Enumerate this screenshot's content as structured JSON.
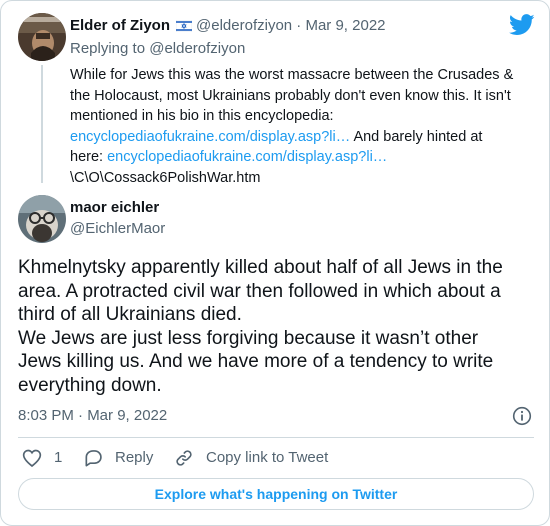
{
  "parent_tweet": {
    "display_name": "Elder of Ziyon",
    "handle": "@elderofziyon",
    "separator": "·",
    "date": "Mar 9, 2022",
    "replying_label": "Replying to @elderofziyon",
    "text_lines": [
      "While for Jews this was the worst massacre between the Crusades &",
      "the Holocaust, most Ukrainians probably don't even know this. It isn't",
      "mentioned in his bio in this encyclopedia:"
    ],
    "link_1": "encyclopediaofukraine.com/display.asp?li…",
    "link_1_after": " And barely hinted at",
    "link_2_before": "here: ",
    "link_2": "encyclopediaofukraine.com/display.asp?li…",
    "last_line": "\\C\\O\\Cossack6PolishWar.htm"
  },
  "main_tweet": {
    "display_name": "maor eichler",
    "handle": "@EichlerMaor",
    "text_lines": [
      "Khmelnytsky apparently killed about half of all Jews in the",
      "area. A protracted civil war then followed in which about a",
      "third of all Ukrainians died.",
      "We Jews are just less forgiving because it wasn’t other",
      "Jews killing us. And we have more of a tendency to write",
      "everything down."
    ],
    "time": "8:03 PM · Mar 9, 2022"
  },
  "actions": {
    "like_count": "1",
    "reply_label": "Reply",
    "copy_link_label": "Copy link to Tweet"
  },
  "explore_button": "Explore what's happening on Twitter",
  "colors": {
    "accent": "#1d9bf0",
    "text": "#0f1419",
    "secondary": "#536471",
    "border": "#cfd9de"
  },
  "icons": [
    "twitter-bird-icon",
    "israel-flag-icon",
    "info-icon",
    "heart-icon",
    "reply-icon",
    "link-icon"
  ]
}
